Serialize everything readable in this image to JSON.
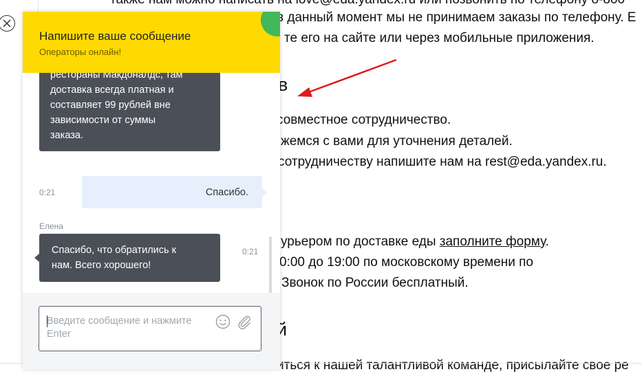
{
  "background": {
    "lines": [
      "также нам можно написать на love@eda.yandex.ru или позвонить по телефону 8-800",
      "в данный момент мы не принимаем заказы по телефону. Е",
      "те его на сайте или через мобильные приложения.",
      "совместное сотрудничество.",
      "жемся с вами для уточнения деталей.",
      "сотрудничеству напишите нам на rest@eda.yandex.ru.",
      "урьером по доставке еды ",
      "0:00 до 19:00 по московскому времени по",
      "Звонок по России бесплатный.",
      "иться к нашей талантливой команде, присылайте свое ре"
    ],
    "link": "заполните форму",
    "link_suffix": ".",
    "headings": [
      "в",
      "й"
    ]
  },
  "chat": {
    "title": "Напишите ваше сообщение",
    "status": "Операторы онлайн!",
    "messages": [
      {
        "role": "operator",
        "text_lines": [
          "рестораны Макдоналдс, там",
          "доставка всегда платная и",
          "составляет 99 рублей вне",
          "зависимости от суммы",
          "заказа."
        ]
      },
      {
        "role": "user",
        "time": "0:21",
        "text": "Спасибо."
      },
      {
        "role": "operator",
        "author": "Елена",
        "time": "0:21",
        "text_lines": [
          "Спасибо, что обратились к",
          "нам. Всего хорошего!"
        ]
      }
    ],
    "input": {
      "placeholder": "Введите сообщение и нажмите Enter",
      "value": ""
    }
  },
  "colors": {
    "header": "#ffda00",
    "operator_bubble": "#4b5058",
    "user_bubble": "#e7effc",
    "arrow": "#e01b1b",
    "online_dot": "#43b75a"
  },
  "icons": [
    "close-icon",
    "emoji-icon",
    "attach-icon",
    "annotation-arrow"
  ]
}
